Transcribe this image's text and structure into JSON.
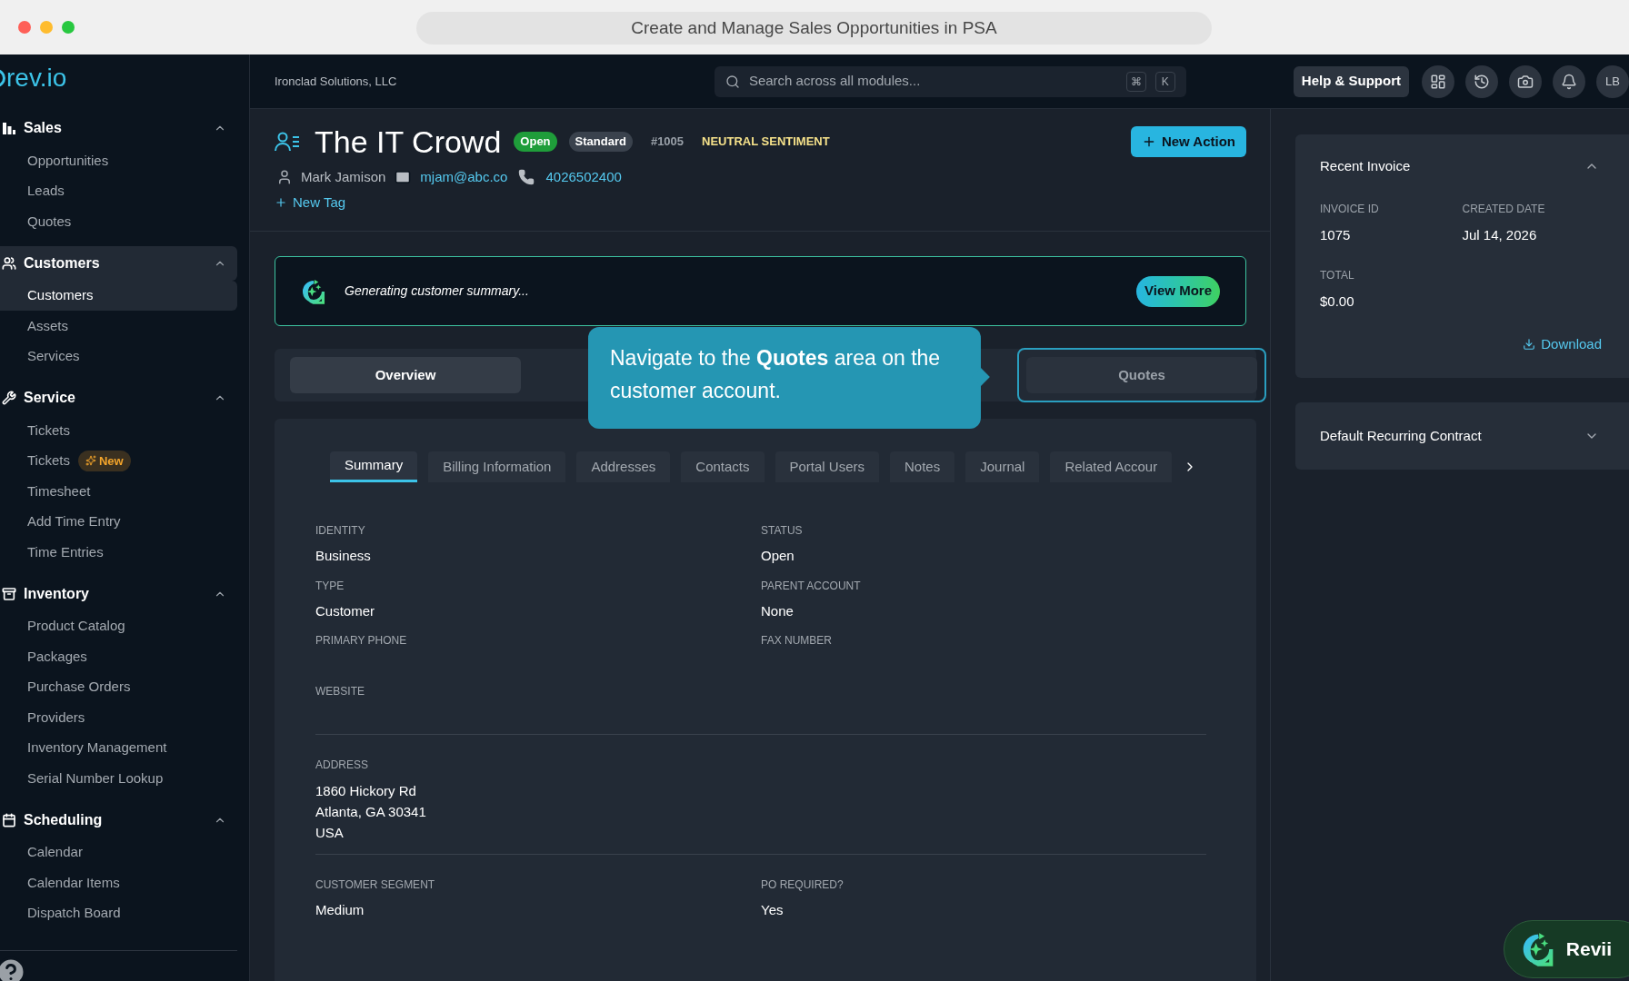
{
  "window": {
    "title": "Create and Manage Sales Opportunities in PSA"
  },
  "header": {
    "organization": "Ironclad Solutions, LLC",
    "search": {
      "placeholder": "Search across all modules...",
      "keys": [
        "⌘",
        "K"
      ]
    },
    "help_button": "Help & Support",
    "avatar": "LB"
  },
  "sidebar": {
    "logo": "rev.io",
    "sections": [
      {
        "label": "Sales",
        "expanded": true,
        "selected": false,
        "items": [
          {
            "label": "Opportunities",
            "selected": false
          },
          {
            "label": "Leads",
            "selected": false
          },
          {
            "label": "Quotes",
            "selected": false
          }
        ]
      },
      {
        "label": "Customers",
        "expanded": true,
        "selected": true,
        "items": [
          {
            "label": "Customers",
            "selected": true
          },
          {
            "label": "Assets",
            "selected": false
          },
          {
            "label": "Services",
            "selected": false
          }
        ]
      },
      {
        "label": "Service",
        "expanded": true,
        "selected": false,
        "items": [
          {
            "label": "Tickets",
            "selected": false
          },
          {
            "label": "Tickets",
            "selected": false,
            "badge": "New"
          },
          {
            "label": "Timesheet",
            "selected": false
          },
          {
            "label": "Add Time Entry",
            "selected": false
          },
          {
            "label": "Time Entries",
            "selected": false
          }
        ]
      },
      {
        "label": "Inventory",
        "expanded": true,
        "selected": false,
        "items": [
          {
            "label": "Product Catalog",
            "selected": false
          },
          {
            "label": "Packages",
            "selected": false
          },
          {
            "label": "Purchase Orders",
            "selected": false
          },
          {
            "label": "Providers",
            "selected": false
          },
          {
            "label": "Inventory Management",
            "selected": false
          },
          {
            "label": "Serial Number Lookup",
            "selected": false
          }
        ]
      },
      {
        "label": "Scheduling",
        "expanded": true,
        "selected": false,
        "items": [
          {
            "label": "Calendar",
            "selected": false
          },
          {
            "label": "Calendar Items",
            "selected": false
          },
          {
            "label": "Dispatch Board",
            "selected": false
          }
        ]
      }
    ]
  },
  "customer": {
    "name": "The IT Crowd",
    "status": "Open",
    "tier": "Standard",
    "number": "#1005",
    "sentiment": "NEUTRAL SENTIMENT",
    "contact": "Mark Jamison",
    "email": "mjam@abc.co",
    "phone": "4026502400",
    "new_tag": "New Tag",
    "new_action": "New Action"
  },
  "summary_banner": {
    "text": "Generating customer summary...",
    "button": "View More"
  },
  "view_tabs": [
    {
      "label": "Overview",
      "selected": true,
      "highlighted": false
    },
    {
      "label": "Quotes",
      "selected": false,
      "highlighted": true
    }
  ],
  "tooltip": {
    "text": "Navigate to the **Quotes** area on the customer account."
  },
  "sub_tabs": [
    {
      "label": "Summary",
      "selected": true
    },
    {
      "label": "Billing Information",
      "selected": false
    },
    {
      "label": "Addresses",
      "selected": false
    },
    {
      "label": "Contacts",
      "selected": false
    },
    {
      "label": "Portal Users",
      "selected": false
    },
    {
      "label": "Notes",
      "selected": false
    },
    {
      "label": "Journal",
      "selected": false
    },
    {
      "label": "Related Accour",
      "selected": false
    }
  ],
  "field_groups": [
    [
      {
        "label": "IDENTITY",
        "value": "Business"
      },
      {
        "label": "STATUS",
        "value": "Open"
      },
      {
        "label": "TYPE",
        "value": "Customer"
      },
      {
        "label": "PARENT ACCOUNT",
        "value": "None"
      },
      {
        "label": "PRIMARY PHONE"
      },
      {
        "label": "FAX NUMBER"
      },
      {
        "label": "WEBSITE"
      }
    ],
    [
      {
        "label": "ADDRESS",
        "lines": [
          "1860 Hickory Rd",
          "Atlanta, GA 30341",
          "USA"
        ]
      }
    ],
    [
      {
        "label": "CUSTOMER SEGMENT",
        "value": "Medium"
      },
      {
        "label": "PO REQUIRED?",
        "value": "Yes"
      }
    ]
  ],
  "recent_invoice": {
    "title": "Recent Invoice",
    "expanded": true,
    "fields": [
      {
        "label": "INVOICE ID",
        "value": "1075"
      },
      {
        "label": "CREATED DATE",
        "value": "Jul 14, 2026"
      },
      {
        "label": "TOTAL",
        "value": "$0.00"
      }
    ],
    "download": "Download"
  },
  "recurring_contract": {
    "title": "Default Recurring Contract",
    "expanded": false
  },
  "assistant": {
    "label": "Revii"
  }
}
